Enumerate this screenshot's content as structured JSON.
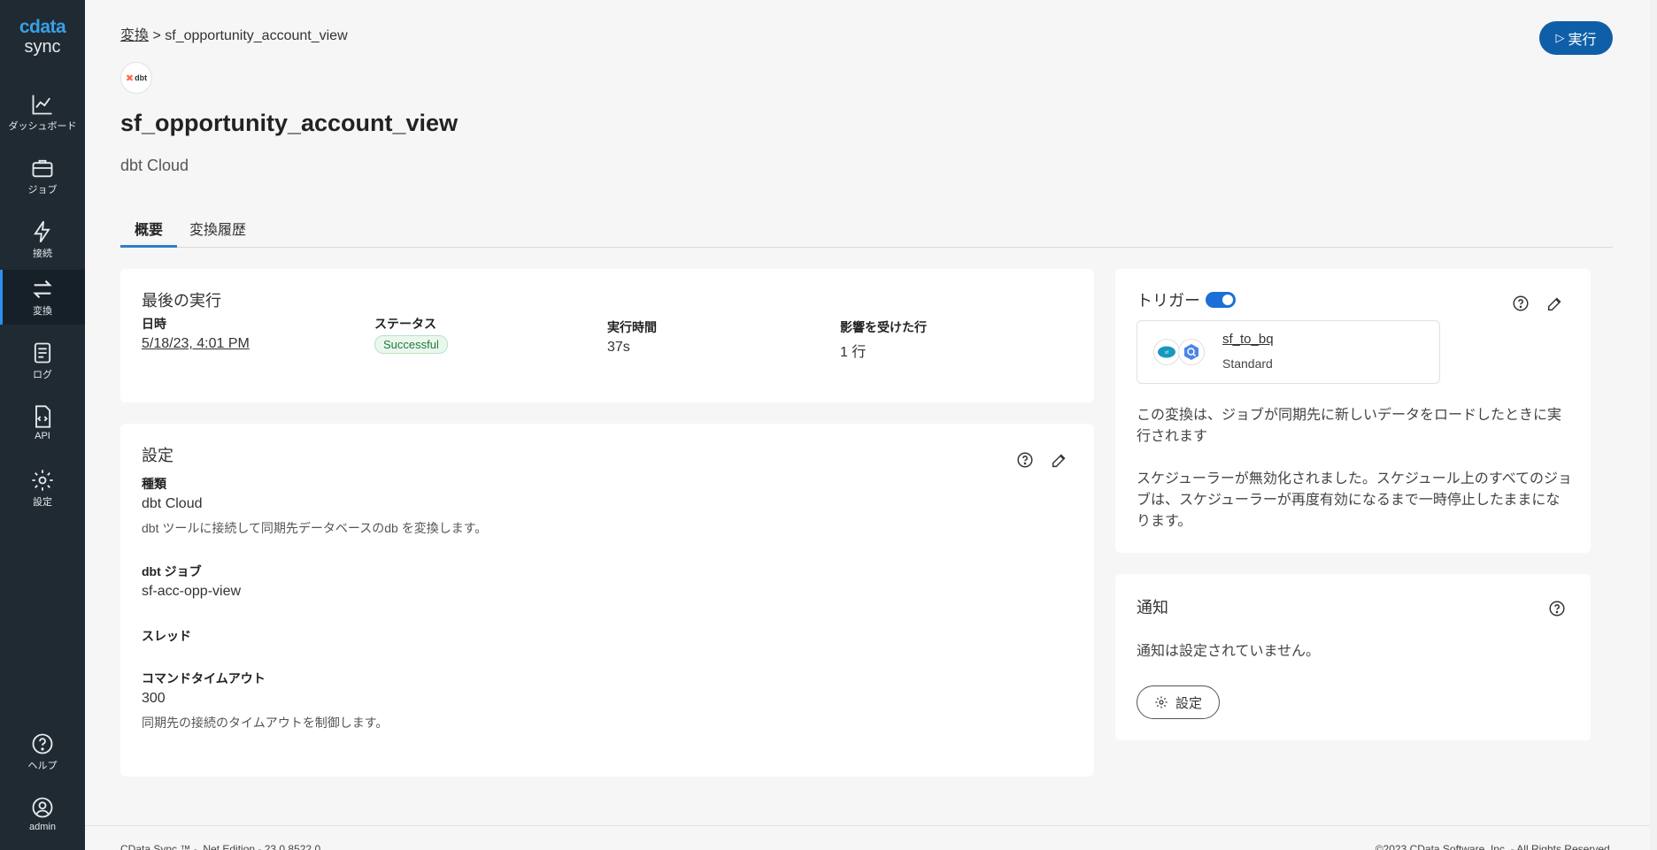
{
  "sidebar": {
    "brand": "cdata",
    "product": "sync",
    "items": [
      {
        "label": "ダッシュボード",
        "icon": "chart-line-icon"
      },
      {
        "label": "ジョブ",
        "icon": "briefcase-icon"
      },
      {
        "label": "接続",
        "icon": "bolt-icon"
      },
      {
        "label": "変換",
        "icon": "transform-arrows-icon",
        "active": true
      },
      {
        "label": "ログ",
        "icon": "book-icon"
      },
      {
        "label": "API",
        "icon": "file-code-icon"
      },
      {
        "label": "設定",
        "icon": "gear-icon"
      }
    ],
    "bottom": [
      {
        "label": "ヘルプ",
        "icon": "help-circle-icon"
      },
      {
        "label": "admin",
        "icon": "user-circle-icon"
      }
    ]
  },
  "breadcrumb": {
    "parent": "変換",
    "separator": ">",
    "current": "sf_opportunity_account_view"
  },
  "header": {
    "run_label": "実行",
    "logo_text": "dbt",
    "title": "sf_opportunity_account_view",
    "subtitle": "dbt Cloud"
  },
  "tabs": [
    {
      "label": "概要",
      "active": true
    },
    {
      "label": "変換履歴",
      "active": false
    }
  ],
  "last_run": {
    "title": "最後の実行",
    "datetime_label": "日時",
    "datetime_value": "5/18/23, 4:01 PM",
    "status_label": "ステータス",
    "status_value": "Successful",
    "duration_label": "実行時間",
    "duration_value": "37s",
    "rows_label": "影響を受けた行",
    "rows_value": "1 行"
  },
  "settings": {
    "title": "設定",
    "type_label": "種類",
    "type_value": "dbt Cloud",
    "type_desc": "dbt ツールに接続して同期先データベースのdb を変換します。",
    "job_label": "dbt ジョブ",
    "job_value": "sf-acc-opp-view",
    "thread_label": "スレッド",
    "timeout_label": "コマンドタイムアウト",
    "timeout_value": "300",
    "timeout_desc": "同期先の接続のタイムアウトを制御します。"
  },
  "trigger": {
    "title": "トリガー",
    "enabled": true,
    "job_name": "sf_to_bq",
    "job_type": "Standard",
    "source_icon": "salesforce-icon",
    "dest_icon": "bigquery-icon",
    "text1": "この変換は、ジョブが同期先に新しいデータをロードしたときに実行されます",
    "text2": "スケジューラーが無効化されました。スケジュール上のすべてのジョブは、スケジューラーが再度有効になるまで一時停止したままになります。"
  },
  "notification": {
    "title": "通知",
    "empty_text": "通知は設定されていません。",
    "button_label": "設定"
  },
  "footer": {
    "left": "CData Sync ™ - .Net Edition - 23.0.8522.0",
    "right": "©2023 CData Software, Inc. - All Rights Reserved."
  },
  "colors": {
    "sidebar_bg": "#1f2a33",
    "accent": "#0f5fa8",
    "tab_underline": "#2f7fc7",
    "success": "#1f7a3a"
  }
}
